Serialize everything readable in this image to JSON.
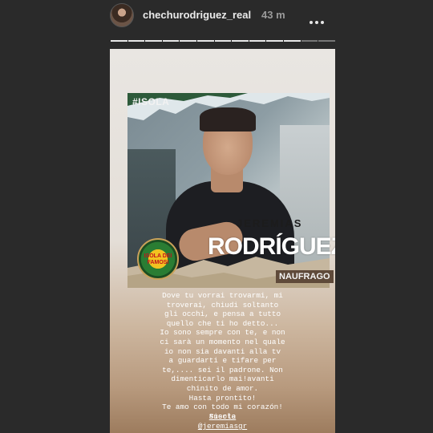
{
  "header": {
    "username": "chechurodriguez_real",
    "time": "43 m",
    "progress_segments": 13,
    "progress_active": 11
  },
  "story": {
    "hashtag": "#ISOLA",
    "first_name": "JEREMIAS",
    "last_name": "RODRÍGUEZ",
    "label": "NAUFRAGO",
    "logo_text": "ISOLA DEI FAMOSI",
    "caption": "Dove tu vorrai trovarmi, mi\ntroverai, chiudi soltanto\ngli occhi, e pensa a tutto\nquello che ti ho detto...\nIo sono sempre con te, e non\nci sarà un momento nel quale\nio non sia davanti alla tv\na guardarti e tifare per\nte,.... sei il padrone. Non\ndimenticarlo mai!avanti\nchinito de amor.\nHasta prontito!\nTe amo con todo mi corazón!\nSuerte",
    "tag_1": "#isola",
    "tag_2": "@jeremiasgr"
  }
}
